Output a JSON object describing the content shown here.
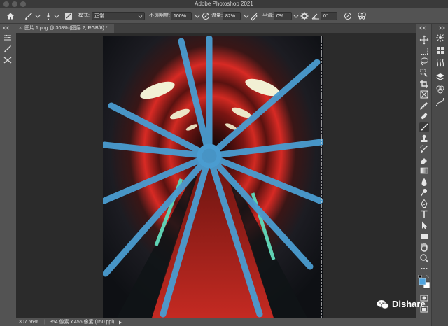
{
  "app": {
    "title": "Adobe Photoshop 2021"
  },
  "options_bar": {
    "mode_label": "模式:",
    "mode_value": "正常",
    "opacity_label": "不透明度:",
    "opacity_value": "100%",
    "flow_label": "流量:",
    "flow_value": "82%",
    "smoothing_label": "平滑:",
    "smoothing_value": "0%",
    "angle_value": "0°"
  },
  "document": {
    "tab_label": "图片 1.png @ 308% (图层 2, RGB/8) *"
  },
  "status": {
    "zoom": "307.66%",
    "doc_info": "354 像素 x 456 像素 (150 ppi)"
  },
  "watermark": {
    "text": "Dishare"
  },
  "colors": {
    "foreground": "#4fa3dd",
    "background": "#ffffff",
    "brush_stroke": "#4a9cd0"
  },
  "tools": [
    "move-tool",
    "marquee-tool",
    "lasso-tool",
    "object-select-tool",
    "crop-tool",
    "frame-tool",
    "eyedropper-tool",
    "healing-brush-tool",
    "brush-tool",
    "clone-stamp-tool",
    "history-brush-tool",
    "eraser-tool",
    "gradient-tool",
    "blur-tool",
    "dodge-tool",
    "pen-tool",
    "type-tool",
    "path-select-tool",
    "rectangle-tool",
    "hand-tool",
    "zoom-tool",
    "more-tools"
  ]
}
